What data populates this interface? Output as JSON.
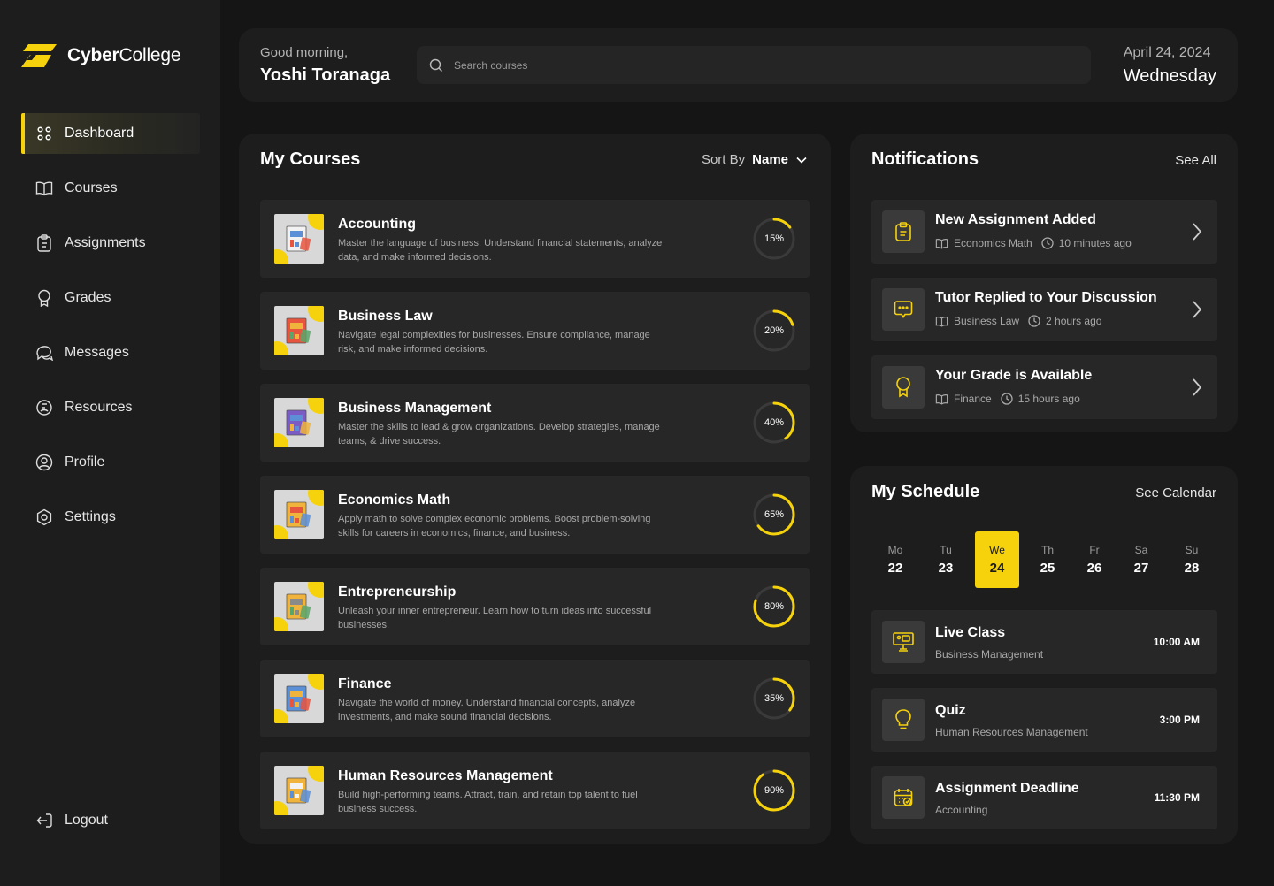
{
  "brand": {
    "name_bold": "Cyber",
    "name_rest": "College",
    "accent": "#f5d20c"
  },
  "sidebar": {
    "items": [
      {
        "label": "Dashboard",
        "icon": "grid-icon",
        "active": true
      },
      {
        "label": "Courses",
        "icon": "book-icon"
      },
      {
        "label": "Assignments",
        "icon": "clipboard-icon"
      },
      {
        "label": "Grades",
        "icon": "badge-icon"
      },
      {
        "label": "Messages",
        "icon": "chat-icon"
      },
      {
        "label": "Resources",
        "icon": "resources-icon"
      },
      {
        "label": "Profile",
        "icon": "user-icon"
      },
      {
        "label": "Settings",
        "icon": "gear-icon"
      }
    ],
    "logout_label": "Logout"
  },
  "header": {
    "greeting": "Good morning,",
    "user_name": "Yoshi Toranaga",
    "search_placeholder": "Search courses",
    "date": "April 24, 2024",
    "weekday": "Wednesday"
  },
  "courses": {
    "title": "My Courses",
    "sort_label": "Sort By",
    "sort_value": "Name",
    "items": [
      {
        "title": "Accounting",
        "desc": "Master the language of business. Understand financial statements, analyze data, and make informed decisions.",
        "progress": 15,
        "progress_label": "15%"
      },
      {
        "title": "Business Law",
        "desc": "Navigate legal complexities for businesses. Ensure compliance, manage risk, and make informed decisions.",
        "progress": 20,
        "progress_label": "20%"
      },
      {
        "title": "Business Management",
        "desc": "Master the skills to lead & grow organizations. Develop strategies, manage teams, & drive success.",
        "progress": 40,
        "progress_label": "40%"
      },
      {
        "title": "Economics Math",
        "desc": "Apply math to solve complex economic problems. Boost problem-solving skills for careers in economics, finance, and business.",
        "progress": 65,
        "progress_label": "65%"
      },
      {
        "title": "Entrepreneurship",
        "desc": "Unleash your inner entrepreneur. Learn how to turn ideas into successful businesses.",
        "progress": 80,
        "progress_label": "80%"
      },
      {
        "title": "Finance",
        "desc": "Navigate the world of money. Understand financial concepts, analyze investments, and make sound financial decisions.",
        "progress": 35,
        "progress_label": "35%"
      },
      {
        "title": "Human Resources Management",
        "desc": "Build high-performing teams. Attract, train, and retain top talent to fuel business success.",
        "progress": 90,
        "progress_label": "90%"
      }
    ]
  },
  "notifications": {
    "title": "Notifications",
    "see_all": "See All",
    "items": [
      {
        "title": "New Assignment Added",
        "course": "Economics Math",
        "time": "10 minutes ago",
        "icon": "clipboard-icon"
      },
      {
        "title": "Tutor Replied to Your Discussion",
        "course": "Business Law",
        "time": "2 hours ago",
        "icon": "message-icon"
      },
      {
        "title": "Your Grade is Available",
        "course": "Finance",
        "time": "15 hours ago",
        "icon": "badge-icon"
      }
    ]
  },
  "schedule": {
    "title": "My Schedule",
    "see_calendar": "See Calendar",
    "days": [
      {
        "name": "Mo",
        "num": "22"
      },
      {
        "name": "Tu",
        "num": "23"
      },
      {
        "name": "We",
        "num": "24",
        "active": true
      },
      {
        "name": "Th",
        "num": "25"
      },
      {
        "name": "Fr",
        "num": "26"
      },
      {
        "name": "Sa",
        "num": "27"
      },
      {
        "name": "Su",
        "num": "28"
      }
    ],
    "events": [
      {
        "title": "Live Class",
        "sub": "Business Management",
        "time": "10:00 AM",
        "icon": "presentation-icon"
      },
      {
        "title": "Quiz",
        "sub": "Human Resources Management",
        "time": "3:00 PM",
        "icon": "lightbulb-icon"
      },
      {
        "title": "Assignment Deadline",
        "sub": "Accounting",
        "time": "11:30 PM",
        "icon": "calendar-check-icon"
      }
    ]
  }
}
